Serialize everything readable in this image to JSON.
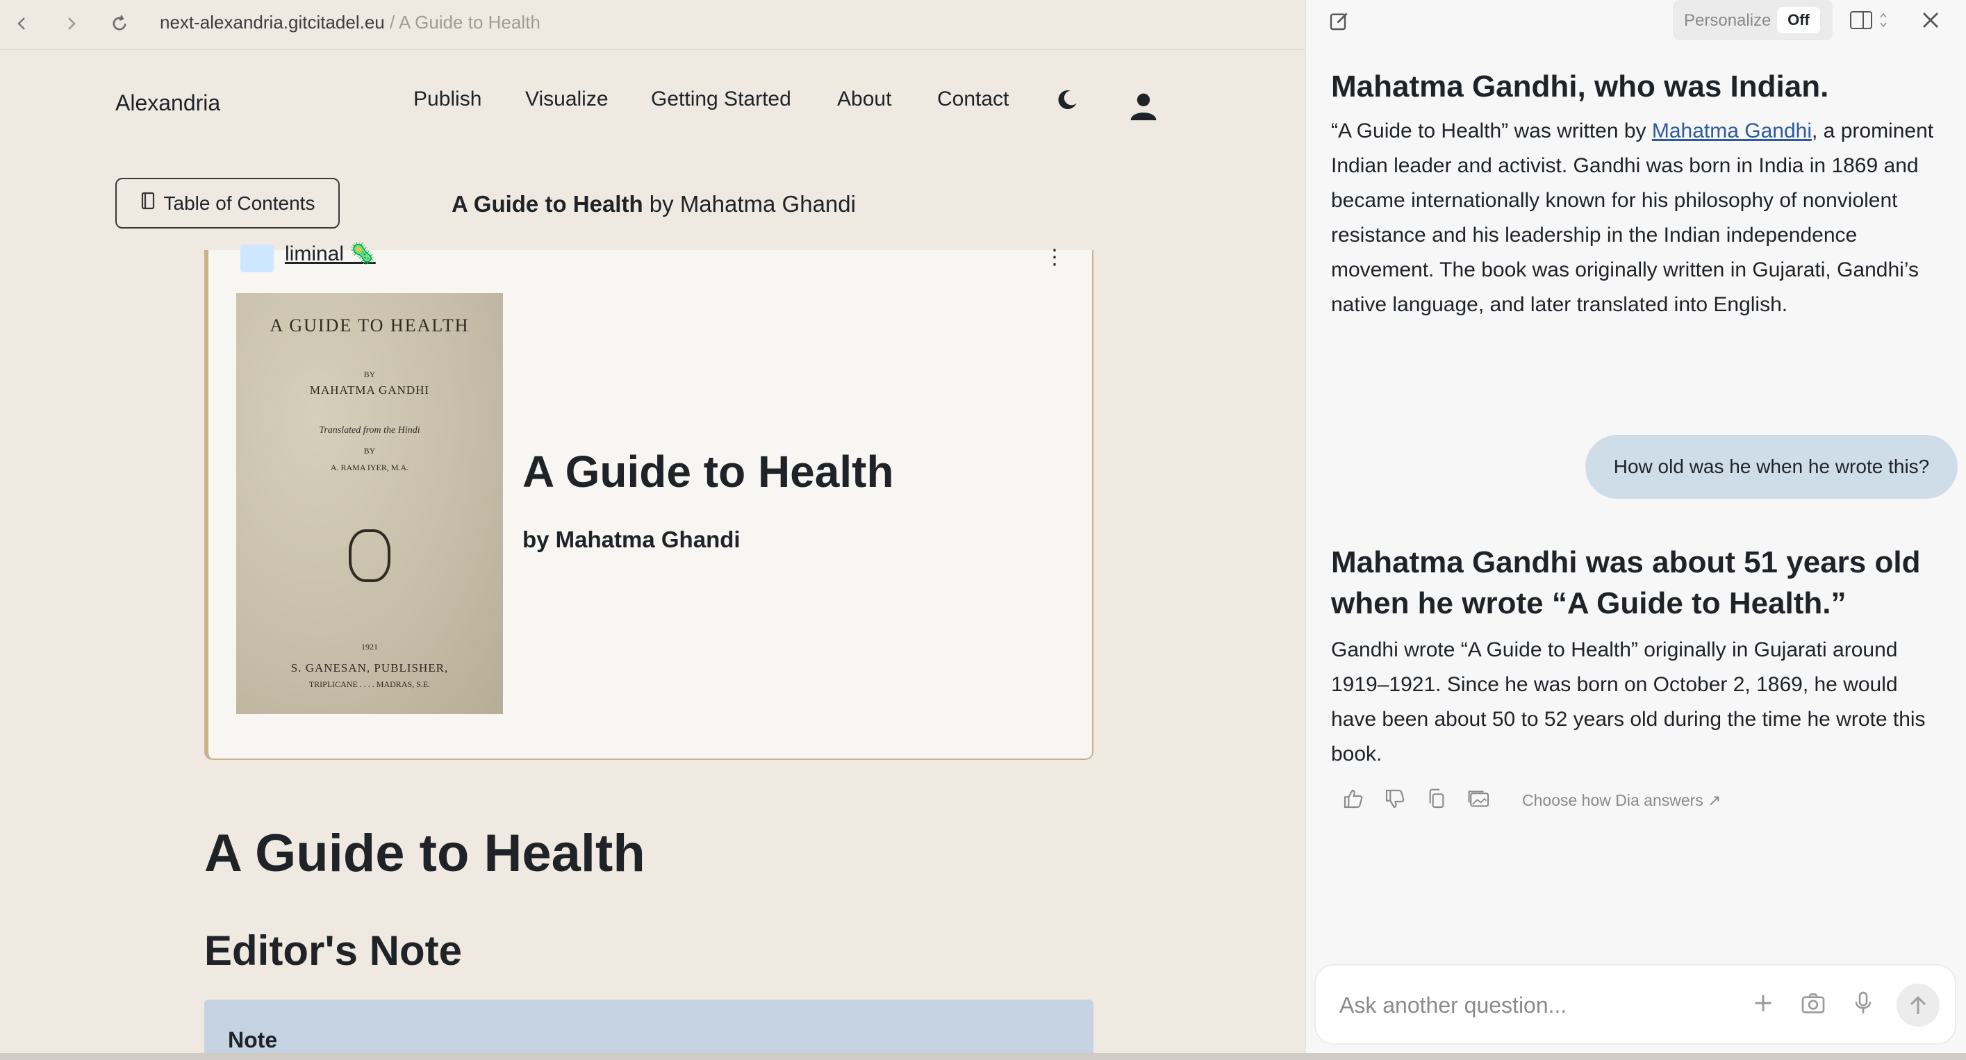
{
  "browser": {
    "url_domain": "next-alexandria.gitcitadel.eu",
    "url_path": " / A Guide to Health",
    "icons": [
      "back-icon",
      "forward-icon",
      "reload-icon"
    ]
  },
  "site": {
    "brand": "Alexandria",
    "nav": [
      "Publish",
      "Visualize",
      "Getting Started",
      "About",
      "Contact"
    ],
    "toc_label": "Table of Contents",
    "heading_title": "A Guide to Health",
    "heading_by": " by Mahatma Ghandi"
  },
  "card": {
    "author": "liminal 🦠",
    "book_title": "A Guide to Health",
    "book_by": "by Mahatma Ghandi",
    "cover": {
      "title": "A GUIDE TO HEALTH",
      "by1": "BY",
      "author": "MAHATMA GANDHI",
      "translated": "Translated from the Hindi",
      "by2": "BY",
      "translator": "A. RAMA IYER, M.A.",
      "year": "1921",
      "publisher": "S. GANESAN, PUBLISHER,",
      "place": "TRIPLICANE . . . . MADRAS, S.E."
    }
  },
  "article": {
    "h1": "A Guide to Health",
    "h2": "Editor's Note",
    "note_label": "Note"
  },
  "assistant": {
    "personalize_label": "Personalize",
    "personalize_state": "Off",
    "answer1_heading": "The writer of “A Guide to Health” is Mahatma Gandhi, who was Indian.",
    "answer1_pre": "“A Guide to Health” was written by ",
    "answer1_link": "Mahatma Gandhi",
    "answer1_post": ", a prominent Indian leader and activist. Gandhi was born in India in 1869 and became internationally known for his philosophy of nonviolent resistance and his leadership in the Indian independence movement. The book was originally written in Gujarati, Gandhi’s native language, and later translated into English.",
    "user_question": "How old was he when he wrote this?",
    "answer2_heading": "Mahatma Gandhi was about 51 years old when he wrote “A Guide to Health.”",
    "answer2_body": "Gandhi wrote “A Guide to Health” originally in Gujarati around 1919–1921. Since he was born on October 2, 1869, he would have been about 50 to 52 years old during the time he wrote this book.",
    "choose_label": "Choose how Dia answers ↗",
    "input_placeholder": "Ask another question..."
  }
}
